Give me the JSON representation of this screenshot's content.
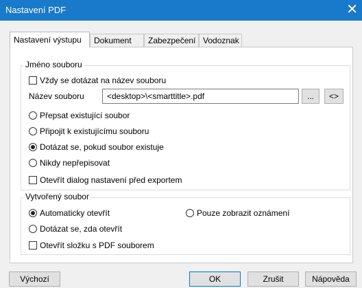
{
  "window": {
    "title": "Nastavení PDF",
    "close_glyph": "✕"
  },
  "tabs": [
    "Nastavení výstupu",
    "Dokument",
    "Zabezpečení",
    "Vodoznak"
  ],
  "filename_group": {
    "title": "Jméno souboru",
    "always_ask": {
      "label": "Vždy se dotázat na název souboru",
      "checked": false
    },
    "name_label": "Název souboru",
    "name_value": "<desktop>\\<smarttitle>.pdf",
    "browse_label": "...",
    "macro_label": "<>",
    "options": [
      {
        "label": "Přepsat existující soubor",
        "checked": false
      },
      {
        "label": "Připojit k existujícímu souboru",
        "checked": false
      },
      {
        "label": "Dotázat se, pokud soubor existuje",
        "checked": true
      },
      {
        "label": "Nikdy nepřepisovat",
        "checked": false
      }
    ],
    "open_settings": {
      "label": "Otevřít dialog nastavení před exportem",
      "checked": false
    }
  },
  "created_group": {
    "title": "Vytvořený soubor",
    "options": [
      {
        "label": "Automaticky otevřít",
        "checked": true
      },
      {
        "label": "Pouze zobrazit oznámení",
        "checked": false
      },
      {
        "label": "Dotázat se, zda otevřít",
        "checked": false
      }
    ],
    "open_folder": {
      "label": "Otevřít složku s PDF souborem",
      "checked": false
    }
  },
  "buttons": {
    "default": "Výchozí",
    "ok": "OK",
    "cancel": "Zrušit",
    "help": "Nápověda"
  }
}
